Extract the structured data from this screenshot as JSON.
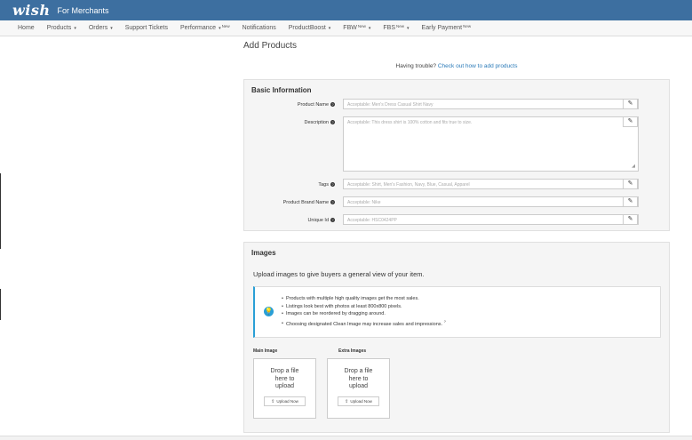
{
  "topbar": {
    "logo": "wish",
    "subtitle": "For Merchants"
  },
  "nav": {
    "home": "Home",
    "products": "Products",
    "orders": "Orders",
    "support": "Support Tickets",
    "performance": "Performance",
    "performance_badge": "New",
    "notifications": "Notifications",
    "productboost": "ProductBoost",
    "fbw": "FBW",
    "fbw_badge": "New",
    "fbs": "FBS",
    "fbs_badge": "New",
    "early_payment": "Early Payment",
    "early_payment_badge": "New",
    "caret": "▾"
  },
  "page": {
    "title": "Add Products",
    "trouble_text": "Having trouble?",
    "trouble_link": "Check out how to add products"
  },
  "basic_info": {
    "title": "Basic Information",
    "edit_icon": "✎",
    "product_name": {
      "label": "Product Name",
      "placeholder": "Acceptable: Men's Dress Casual Shirt Navy"
    },
    "description": {
      "label": "Description",
      "placeholder": "Acceptable: This dress shirt is 100% cotton and fits true to size."
    },
    "tags": {
      "label": "Tags",
      "placeholder": "Acceptable: Shirt, Men's Fashion, Navy, Blue, Casual, Apparel"
    },
    "brand": {
      "label": "Product Brand Name",
      "placeholder": "Acceptable: Nike"
    },
    "unique_id": {
      "label": "Unique Id",
      "placeholder": "Acceptable: HSC0424PP"
    }
  },
  "images": {
    "title": "Images",
    "description": "Upload images to give buyers a general view of your item.",
    "tips": [
      "Products with multiple high quality images get the most sales.",
      "Listings look best with photos at least 800x800 pixels.",
      "Images can be reordered by dragging around.",
      "Choosing designated Clean Image may increase sales and impressions."
    ],
    "tips_sup": "?",
    "main_image_label": "Main Image",
    "extra_images_label": "Extra Images",
    "drop_text": "Drop a file here to upload",
    "upload_button": "Upload Now"
  }
}
